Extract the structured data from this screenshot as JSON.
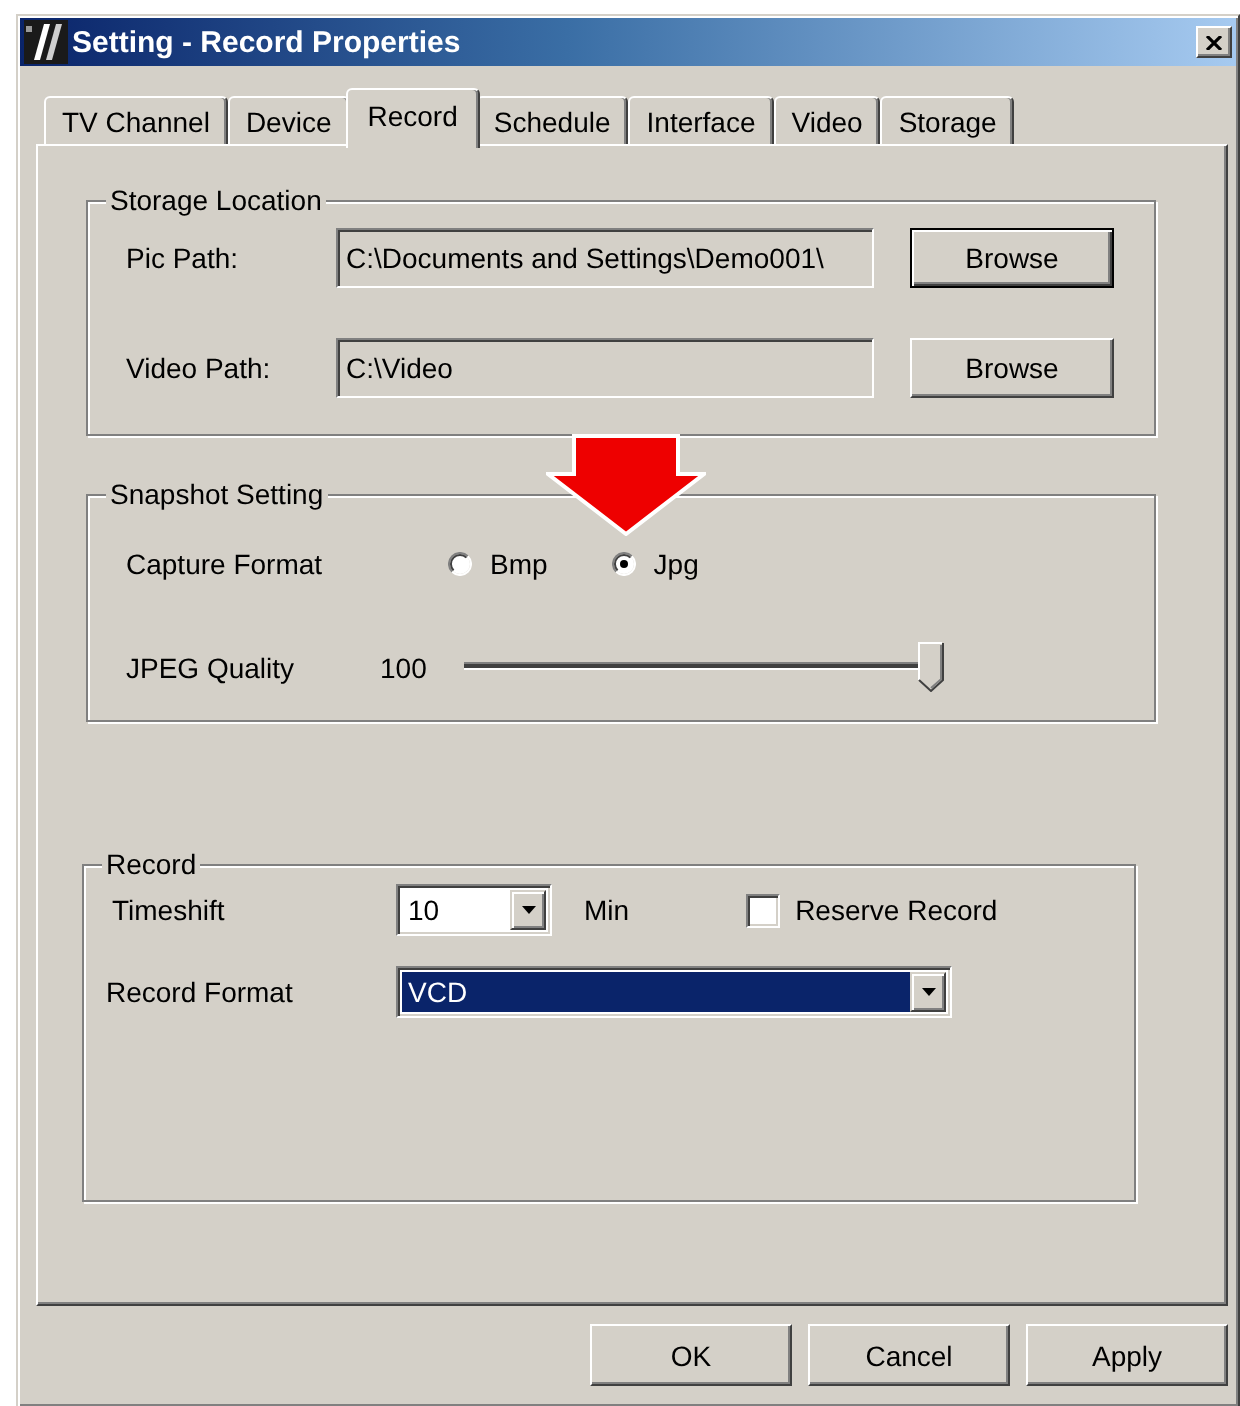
{
  "window": {
    "title": "Setting - Record Properties"
  },
  "tabs": [
    {
      "label": "TV Channel",
      "selected": false
    },
    {
      "label": "Device",
      "selected": false
    },
    {
      "label": "Record",
      "selected": true
    },
    {
      "label": "Schedule",
      "selected": false
    },
    {
      "label": "Interface",
      "selected": false
    },
    {
      "label": "Video",
      "selected": false
    },
    {
      "label": "Storage",
      "selected": false
    }
  ],
  "storage_location": {
    "title": "Storage Location",
    "paths": [
      {
        "label": "Pic Path:",
        "value": "C:\\Documents and Settings\\Demo001\\",
        "read_only": true,
        "button": {
          "label": "Browse",
          "default": true
        }
      },
      {
        "label": "Video Path:",
        "value": "C:\\Video",
        "read_only": true,
        "button": {
          "label": "Browse",
          "default": false
        }
      }
    ]
  },
  "snapshot_setting": {
    "title": "Snapshot Setting",
    "capture_format": {
      "label": "Capture Format",
      "options": [
        {
          "label": "Bmp",
          "selected": false
        },
        {
          "label": "Jpg",
          "selected": true
        }
      ]
    },
    "jpeg_quality": {
      "label": "JPEG Quality",
      "reading": "100",
      "level": 1
    }
  },
  "record": {
    "title": "Record",
    "timeshift": {
      "label": "Timeshift",
      "value": "10",
      "unit": "Min"
    },
    "reserve_record": {
      "label": "Reserve Record",
      "checked": false
    },
    "record_format": {
      "label": "Record Format",
      "value": "VCD",
      "focused": true
    }
  },
  "buttons": [
    {
      "label": "OK"
    },
    {
      "label": "Cancel"
    },
    {
      "label": "Apply"
    }
  ]
}
